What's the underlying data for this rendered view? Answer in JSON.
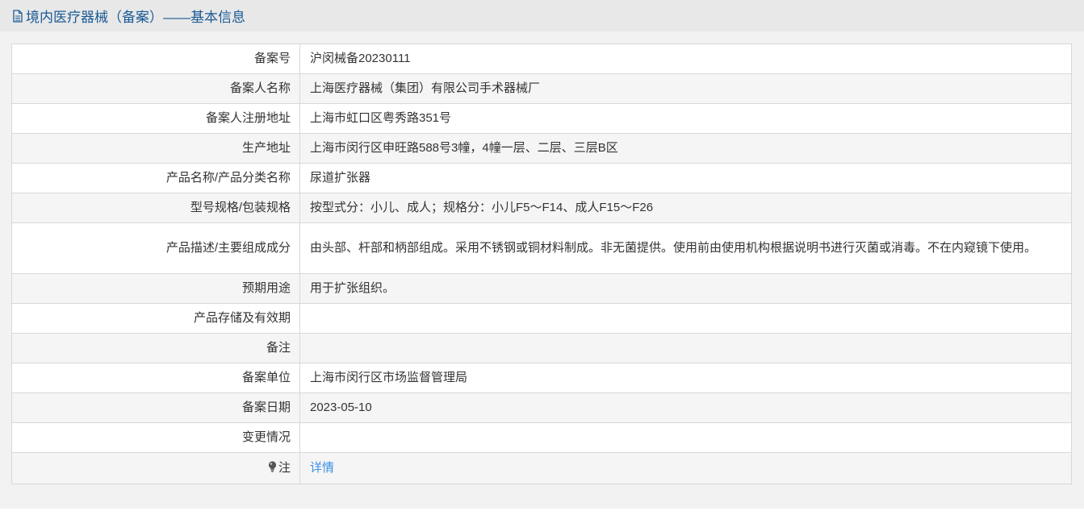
{
  "header": {
    "title": "境内医疗器械（备案）——基本信息",
    "icon": "document-icon"
  },
  "record": {
    "rows": [
      {
        "label": "备案号",
        "value": "沪闵械备20230111"
      },
      {
        "label": "备案人名称",
        "value": "上海医疗器械（集团）有限公司手术器械厂"
      },
      {
        "label": "备案人注册地址",
        "value": "上海市虹口区粤秀路351号"
      },
      {
        "label": "生产地址",
        "value": "上海市闵行区申旺路588号3幢，4幢一层、二层、三层B区"
      },
      {
        "label": "产品名称/产品分类名称",
        "value": "尿道扩张器"
      },
      {
        "label": "型号规格/包装规格",
        "value": "按型式分：小儿、成人；规格分：小儿F5～F14、成人F15～F26"
      },
      {
        "label": "产品描述/主要组成成分",
        "value": "由头部、杆部和柄部组成。采用不锈钢或铜材料制成。非无菌提供。使用前由使用机构根据说明书进行灭菌或消毒。不在内窥镜下使用。"
      },
      {
        "label": "预期用途",
        "value": "用于扩张组织。"
      },
      {
        "label": "产品存储及有效期",
        "value": ""
      },
      {
        "label": "备注",
        "value": ""
      },
      {
        "label": "备案单位",
        "value": "上海市闵行区市场监督管理局"
      },
      {
        "label": "备案日期",
        "value": "2023-05-10"
      },
      {
        "label": "变更情况",
        "value": ""
      }
    ],
    "note": {
      "label": "注",
      "icon": "lightbulb-icon",
      "link_text": "详情",
      "link_color": "#3a8ee6"
    }
  },
  "colors": {
    "header_bg": "#e8e8e8",
    "header_text": "#1a5a96",
    "panel_bg": "#f2f2f2",
    "row_alt_bg": "#f5f5f5",
    "border": "#d8d8d8"
  }
}
